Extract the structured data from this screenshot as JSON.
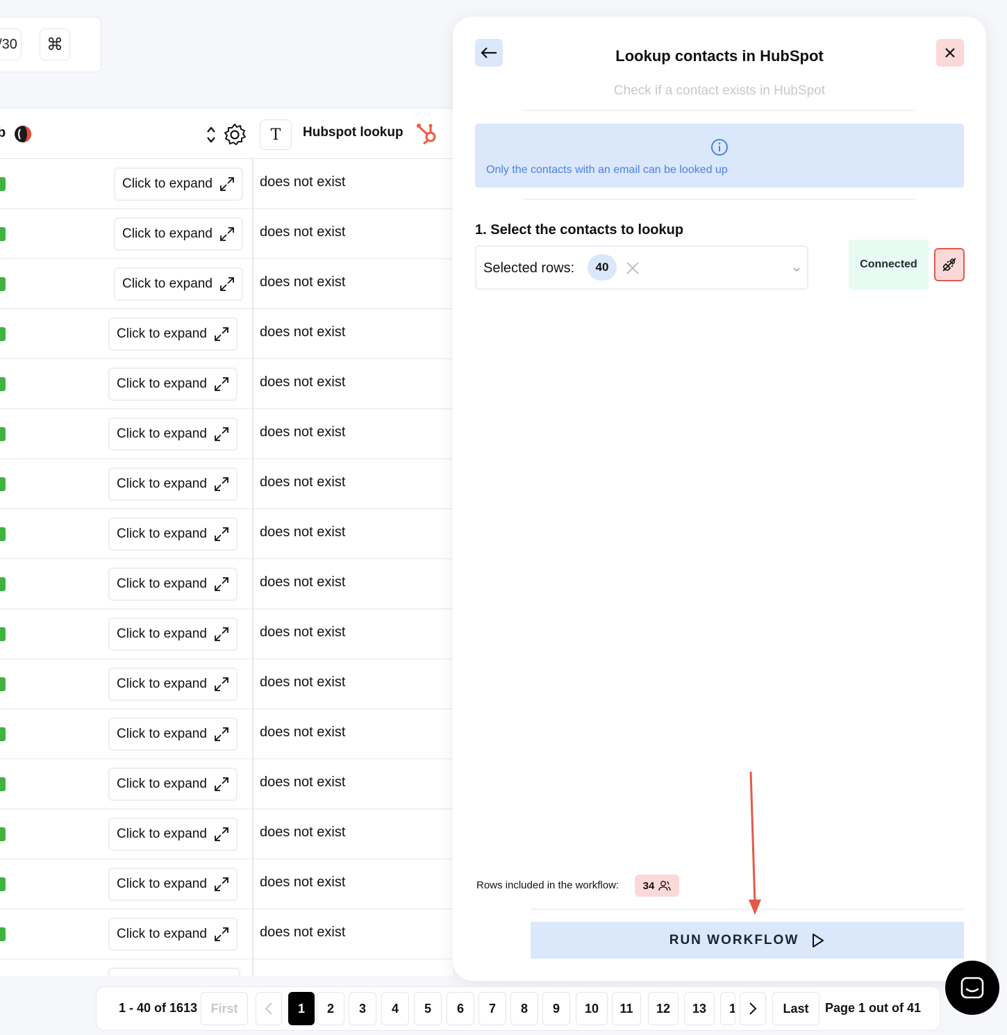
{
  "toolbar": {
    "count_fragment": "/30",
    "command_icon": "⌘"
  },
  "table": {
    "left_header_fragment": "b",
    "lookup_header": "Hubspot lookup",
    "lookup_type_glyph": "T",
    "rows": [
      {
        "expand_label": "Click to expand",
        "value": "does not exist"
      },
      {
        "expand_label": "Click to expand",
        "value": "does not exist"
      },
      {
        "expand_label": "Click to expand",
        "value": "does not exist"
      },
      {
        "expand_label": "Click to expand",
        "value": "does not exist"
      },
      {
        "expand_label": "Click to expand",
        "value": "does not exist"
      },
      {
        "expand_label": "Click to expand",
        "value": "does not exist"
      },
      {
        "expand_label": "Click to expand",
        "value": "does not exist"
      },
      {
        "expand_label": "Click to expand",
        "value": "does not exist"
      },
      {
        "expand_label": "Click to expand",
        "value": "does not exist"
      },
      {
        "expand_label": "Click to expand",
        "value": "does not exist"
      },
      {
        "expand_label": "Click to expand",
        "value": "does not exist"
      },
      {
        "expand_label": "Click to expand",
        "value": "does not exist"
      },
      {
        "expand_label": "Click to expand",
        "value": "does not exist"
      },
      {
        "expand_label": "Click to expand",
        "value": "does not exist"
      },
      {
        "expand_label": "Click to expand",
        "value": "does not exist"
      },
      {
        "expand_label": "Click to expand",
        "value": "does not exist"
      }
    ]
  },
  "panel": {
    "title": "Lookup contacts in HubSpot",
    "subtitle": "Check if a contact exists in HubSpot",
    "info_text": "Only the contacts with an email can be looked up",
    "section_title": "1. Select the contacts to lookup",
    "select_label": "Selected rows:",
    "selected_count": "40",
    "connected_label": "Connected",
    "rows_included_label": "Rows included in the workflow:",
    "rows_included_count": "34",
    "run_label": "RUN WORKFLOW"
  },
  "pagination": {
    "range": "1 - 40 of 1613",
    "first": "First",
    "last": "Last",
    "pages": [
      "1",
      "2",
      "3",
      "4",
      "5",
      "6",
      "7",
      "8",
      "9",
      "10",
      "11",
      "12",
      "13",
      "1"
    ],
    "current_page": "1",
    "page_info": "Page 1 out of 41"
  },
  "colors": {
    "accent_blue": "#dbe8fb",
    "info_text_blue": "#4a7fe0",
    "danger_red": "#e25a4b",
    "danger_bg": "#fbd9d9",
    "connected_bg": "#e8fbf2",
    "hubspot_orange": "#f05a3e",
    "status_green": "#3fb33f"
  },
  "icons": [
    "command-icon",
    "sort-icon",
    "gear-icon",
    "hubspot-icon",
    "expand-icon",
    "back-arrow-icon",
    "close-icon",
    "info-icon",
    "clear-icon",
    "chevron-down-icon",
    "unplug-icon",
    "users-icon",
    "play-icon",
    "chevron-left-icon",
    "chevron-right-icon",
    "chat-icon"
  ]
}
